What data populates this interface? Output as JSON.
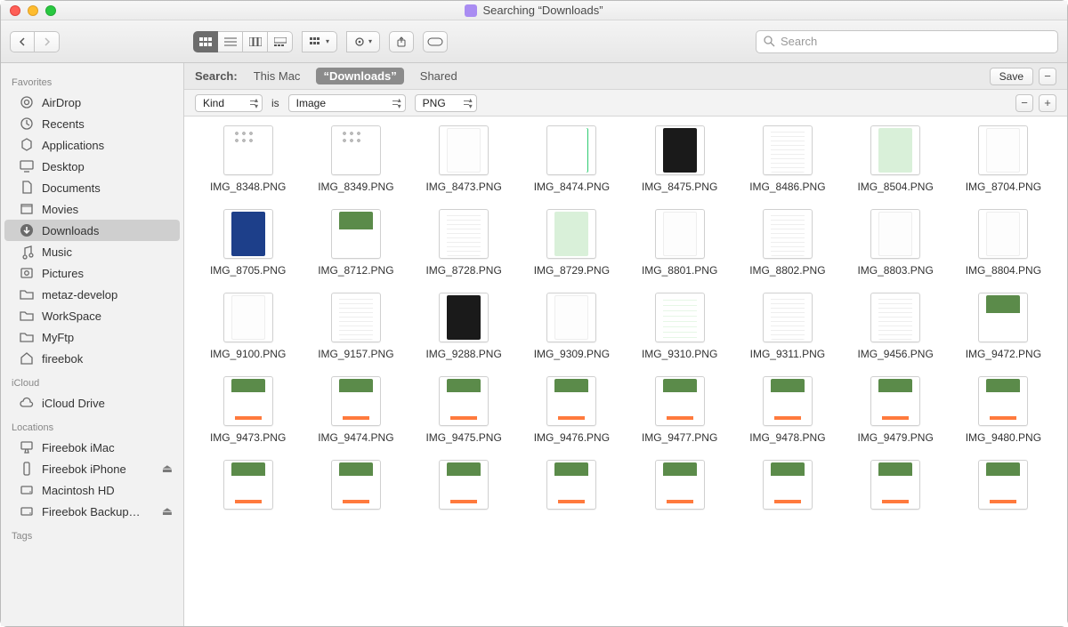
{
  "window": {
    "title": "Searching “Downloads”"
  },
  "search": {
    "placeholder": "Search",
    "value": ""
  },
  "sidebar": {
    "sections": [
      {
        "title": "Favorites",
        "items": [
          {
            "icon": "airdrop",
            "label": "AirDrop"
          },
          {
            "icon": "recents",
            "label": "Recents"
          },
          {
            "icon": "apps",
            "label": "Applications"
          },
          {
            "icon": "desktop",
            "label": "Desktop"
          },
          {
            "icon": "documents",
            "label": "Documents"
          },
          {
            "icon": "movies",
            "label": "Movies"
          },
          {
            "icon": "downloads",
            "label": "Downloads",
            "selected": true
          },
          {
            "icon": "music",
            "label": "Music"
          },
          {
            "icon": "pictures",
            "label": "Pictures"
          },
          {
            "icon": "folder",
            "label": "metaz-develop"
          },
          {
            "icon": "folder",
            "label": "WorkSpace"
          },
          {
            "icon": "folder",
            "label": "MyFtp"
          },
          {
            "icon": "home",
            "label": "fireebok"
          }
        ]
      },
      {
        "title": "iCloud",
        "items": [
          {
            "icon": "cloud",
            "label": "iCloud Drive"
          }
        ]
      },
      {
        "title": "Locations",
        "items": [
          {
            "icon": "imac",
            "label": "Fireebok iMac"
          },
          {
            "icon": "phone",
            "label": "Fireebok iPhone",
            "eject": true
          },
          {
            "icon": "hdd",
            "label": "Macintosh HD"
          },
          {
            "icon": "hdd",
            "label": "Fireebok Backup…",
            "eject": true
          }
        ]
      },
      {
        "title": "Tags",
        "items": []
      }
    ]
  },
  "scopebar": {
    "label": "Search:",
    "options": [
      "This Mac",
      "“Downloads”",
      "Shared"
    ],
    "active_index": 1,
    "save": "Save"
  },
  "filterbar": {
    "attr": "Kind",
    "is": "is",
    "val1": "Image",
    "val2": "PNG"
  },
  "files": [
    {
      "name": "IMG_8348.PNG",
      "ty": "grid"
    },
    {
      "name": "IMG_8349.PNG",
      "ty": "grid"
    },
    {
      "name": "IMG_8473.PNG",
      "ty": "white"
    },
    {
      "name": "IMG_8474.PNG",
      "ty": "green"
    },
    {
      "name": "IMG_8475.PNG",
      "ty": "dark"
    },
    {
      "name": "IMG_8486.PNG",
      "ty": "list"
    },
    {
      "name": "IMG_8504.PNG",
      "ty": "map"
    },
    {
      "name": "IMG_8704.PNG",
      "ty": "white"
    },
    {
      "name": "IMG_8705.PNG",
      "ty": "blue"
    },
    {
      "name": "IMG_8712.PNG",
      "ty": "photo"
    },
    {
      "name": "IMG_8728.PNG",
      "ty": "list"
    },
    {
      "name": "IMG_8729.PNG",
      "ty": "map"
    },
    {
      "name": "IMG_8801.PNG",
      "ty": "white"
    },
    {
      "name": "IMG_8802.PNG",
      "ty": "list"
    },
    {
      "name": "IMG_8803.PNG",
      "ty": "white"
    },
    {
      "name": "IMG_8804.PNG",
      "ty": "white"
    },
    {
      "name": "IMG_9100.PNG",
      "ty": "white"
    },
    {
      "name": "IMG_9157.PNG",
      "ty": "list"
    },
    {
      "name": "IMG_9288.PNG",
      "ty": "dark"
    },
    {
      "name": "IMG_9309.PNG",
      "ty": "white"
    },
    {
      "name": "IMG_9310.PNG",
      "ty": "greenlist"
    },
    {
      "name": "IMG_9311.PNG",
      "ty": "list"
    },
    {
      "name": "IMG_9456.PNG",
      "ty": "list"
    },
    {
      "name": "IMG_9472.PNG",
      "ty": "photo"
    },
    {
      "name": "IMG_9473.PNG",
      "ty": "card"
    },
    {
      "name": "IMG_9474.PNG",
      "ty": "card"
    },
    {
      "name": "IMG_9475.PNG",
      "ty": "card"
    },
    {
      "name": "IMG_9476.PNG",
      "ty": "card"
    },
    {
      "name": "IMG_9477.PNG",
      "ty": "card"
    },
    {
      "name": "IMG_9478.PNG",
      "ty": "card"
    },
    {
      "name": "IMG_9479.PNG",
      "ty": "card"
    },
    {
      "name": "IMG_9480.PNG",
      "ty": "card"
    },
    {
      "name": "",
      "ty": "card"
    },
    {
      "name": "",
      "ty": "card"
    },
    {
      "name": "",
      "ty": "card"
    },
    {
      "name": "",
      "ty": "card"
    },
    {
      "name": "",
      "ty": "card"
    },
    {
      "name": "",
      "ty": "card"
    },
    {
      "name": "",
      "ty": "card"
    },
    {
      "name": "",
      "ty": "card"
    }
  ]
}
